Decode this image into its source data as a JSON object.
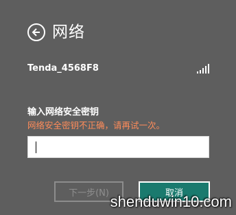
{
  "header": {
    "title": "网络",
    "back_icon": "arrow-left-circle-icon"
  },
  "network": {
    "ssid": "Tenda_4568F8",
    "signal_icon": "wifi-signal-bars-icon",
    "signal_level": 5
  },
  "security_key": {
    "label": "输入网络安全密钥",
    "error": "网络安全密钥不正确，请再试一次。",
    "value": "",
    "error_color": "#ff8c5a"
  },
  "buttons": {
    "next_label": "下一步(N)",
    "cancel_label": "取消"
  },
  "watermark": "shenduwin10.com"
}
